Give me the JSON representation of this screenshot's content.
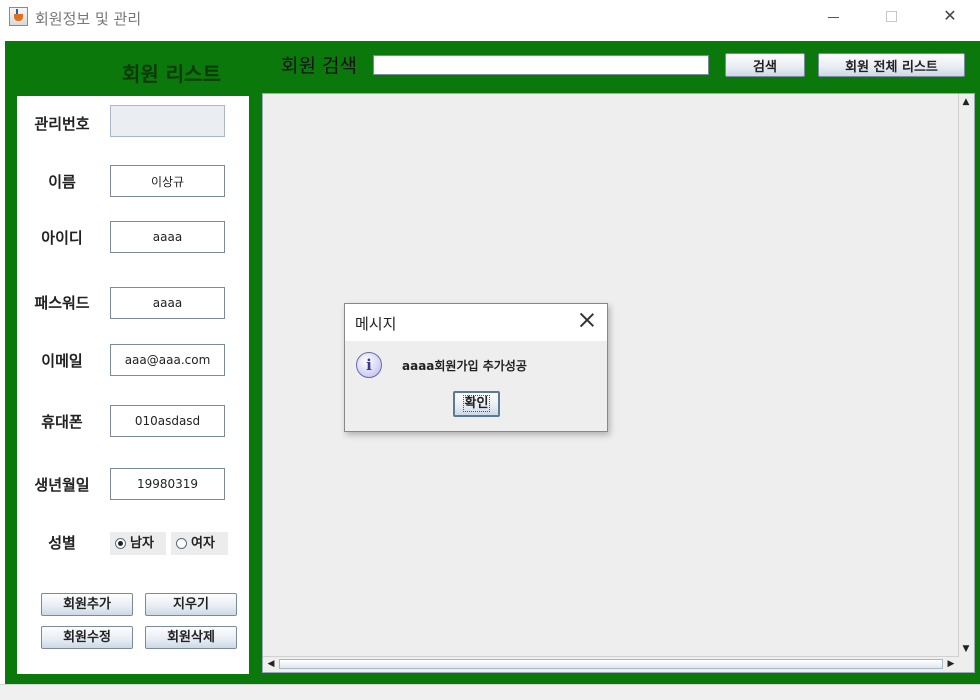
{
  "window": {
    "title": "회원정보 및 관리",
    "minimize_glyph": "—",
    "close_glyph": "✕"
  },
  "header": {
    "list_title": "회원 리스트",
    "search_label": "회원 검색",
    "search_value": "",
    "search_button": "검색",
    "all_list_button": "회원 전체 리스트"
  },
  "form": {
    "fields": [
      {
        "label": "관리번호",
        "value": ""
      },
      {
        "label": "이름",
        "value": "이상규"
      },
      {
        "label": "아이디",
        "value": "aaaa"
      },
      {
        "label": "패스워드",
        "value": "aaaa"
      },
      {
        "label": "이메일",
        "value": "aaa@aaa.com"
      },
      {
        "label": "휴대폰",
        "value": "010asdasd"
      },
      {
        "label": "생년월일",
        "value": "19980319"
      }
    ],
    "gender_label": "성별",
    "gender_options": [
      {
        "label": "남자",
        "checked": true
      },
      {
        "label": "여자",
        "checked": false
      }
    ],
    "buttons": {
      "add": "회원추가",
      "clear": "지우기",
      "edit": "회원수정",
      "delete": "회원삭제"
    }
  },
  "table": {
    "up_arrow": "▲",
    "down_arrow": "▼",
    "left_arrow": "◀",
    "right_arrow": "▶"
  },
  "dialog": {
    "title": "메시지",
    "icon": "info-icon",
    "icon_glyph": "i",
    "message": "aaaa회원가입 추가성공",
    "ok_button": "확인"
  },
  "colors": {
    "frame_green": "#0a780a",
    "panel_bg": "#eeeeee"
  }
}
